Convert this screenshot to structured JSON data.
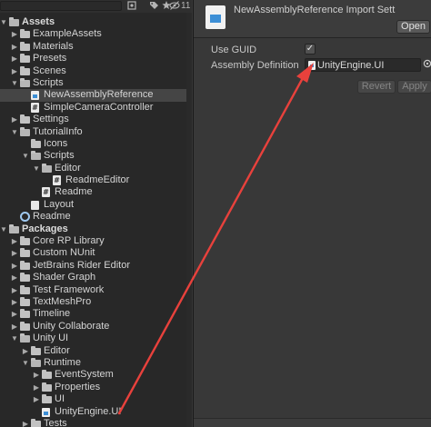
{
  "project_toolbar": {
    "search_placeholder": "",
    "icons": [
      "search-icon",
      "tag-icon",
      "favorite-icon",
      "hidden-eye-icon"
    ],
    "hidden_count": "11"
  },
  "project_tree": {
    "rows": [
      {
        "label": "Assets",
        "bold": true,
        "arrow": "open",
        "icon": "folder-open"
      },
      {
        "label": "ExampleAssets",
        "arrow": "closed",
        "icon": "folder"
      },
      {
        "label": "Materials",
        "arrow": "closed",
        "icon": "folder"
      },
      {
        "label": "Presets",
        "arrow": "closed",
        "icon": "folder"
      },
      {
        "label": "Scenes",
        "arrow": "closed",
        "icon": "folder"
      },
      {
        "label": "Scripts",
        "arrow": "open",
        "icon": "folder-open"
      },
      {
        "label": "NewAssemblyReference",
        "icon": "asmref",
        "selected": true
      },
      {
        "label": "SimpleCameraController",
        "icon": "cs"
      },
      {
        "label": "Settings",
        "arrow": "closed",
        "icon": "folder"
      },
      {
        "label": "TutorialInfo",
        "arrow": "open",
        "icon": "folder-open"
      },
      {
        "label": "Icons",
        "icon": "folder"
      },
      {
        "label": "Scripts",
        "arrow": "open",
        "icon": "folder-open"
      },
      {
        "label": "Editor",
        "arrow": "open",
        "icon": "folder-open"
      },
      {
        "label": "ReadmeEditor",
        "icon": "cs"
      },
      {
        "label": "Readme",
        "icon": "cs"
      },
      {
        "label": "Layout",
        "icon": "file"
      },
      {
        "label": "Readme",
        "icon": "unity"
      },
      {
        "label": "Packages",
        "bold": true,
        "arrow": "open",
        "icon": "folder-open"
      },
      {
        "label": "Core RP Library",
        "arrow": "closed",
        "icon": "folder"
      },
      {
        "label": "Custom NUnit",
        "arrow": "closed",
        "icon": "folder"
      },
      {
        "label": "JetBrains Rider Editor",
        "arrow": "closed",
        "icon": "folder"
      },
      {
        "label": "Shader Graph",
        "arrow": "closed",
        "icon": "folder"
      },
      {
        "label": "Test Framework",
        "arrow": "closed",
        "icon": "folder"
      },
      {
        "label": "TextMeshPro",
        "arrow": "closed",
        "icon": "folder"
      },
      {
        "label": "Timeline",
        "arrow": "closed",
        "icon": "folder"
      },
      {
        "label": "Unity Collaborate",
        "arrow": "closed",
        "icon": "folder"
      },
      {
        "label": "Unity UI",
        "arrow": "open",
        "icon": "folder-open"
      },
      {
        "label": "Editor",
        "arrow": "closed",
        "icon": "folder"
      },
      {
        "label": "Runtime",
        "arrow": "open",
        "icon": "folder-open"
      },
      {
        "label": "EventSystem",
        "arrow": "closed",
        "icon": "folder"
      },
      {
        "label": "Properties",
        "arrow": "closed",
        "icon": "folder"
      },
      {
        "label": "UI",
        "arrow": "closed",
        "icon": "folder"
      },
      {
        "label": "UnityEngine.UI",
        "icon": "asmdef"
      },
      {
        "label": "Tests",
        "arrow": "closed",
        "icon": "folder"
      }
    ]
  },
  "inspector": {
    "title": "NewAssemblyReference Import Sett",
    "open_label": "Open",
    "use_guid_label": "Use GUID",
    "use_guid_checked": true,
    "use_guid_check_glyph": "✓",
    "assembly_definition_label": "Assembly Definition",
    "assembly_definition_value": "UnityEngine.UI",
    "revert_label": "Revert",
    "apply_label": "Apply"
  },
  "colors": {
    "annotation_arrow": "#e8413c",
    "selection": "#454545",
    "panel_dark": "#282828",
    "inspector_bg": "#383838"
  }
}
